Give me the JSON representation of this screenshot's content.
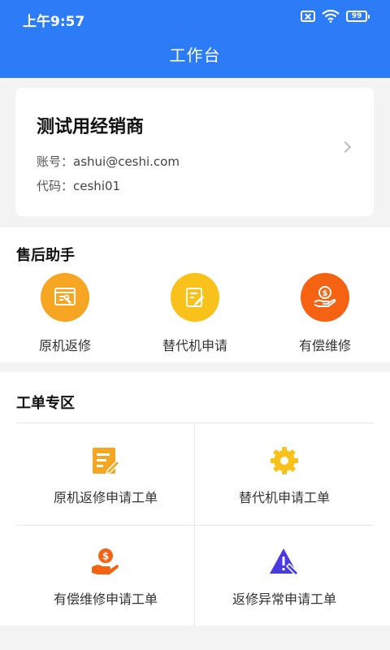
{
  "status": {
    "time": "上午9:57",
    "battery": "99"
  },
  "header": {
    "title": "工作台"
  },
  "dealer": {
    "name": "测试用经销商",
    "account_label": "账号：",
    "account_value": "ashui@ceshi.com",
    "code_label": "代码：",
    "code_value": "ceshi01"
  },
  "aftersales": {
    "title": "售后助手",
    "items": [
      {
        "label": "原机返修",
        "icon": "repair-screen-icon",
        "color": "#f6a623"
      },
      {
        "label": "替代机申请",
        "icon": "edit-document-icon",
        "color": "#f8c21b"
      },
      {
        "label": "有偿维修",
        "icon": "hand-money-icon",
        "color": "#f56312"
      }
    ]
  },
  "workorders": {
    "title": "工单专区",
    "items": [
      {
        "label": "原机返修申请工单",
        "icon": "edit-list-icon",
        "color": "#f5a623"
      },
      {
        "label": "替代机申请工单",
        "icon": "gear-icon",
        "color": "#f8c21b"
      },
      {
        "label": "有偿维修申请工单",
        "icon": "hand-money-icon",
        "color": "#f56312"
      },
      {
        "label": "返修异常申请工单",
        "icon": "warning-wrench-icon",
        "color": "#4a3be0"
      }
    ]
  }
}
